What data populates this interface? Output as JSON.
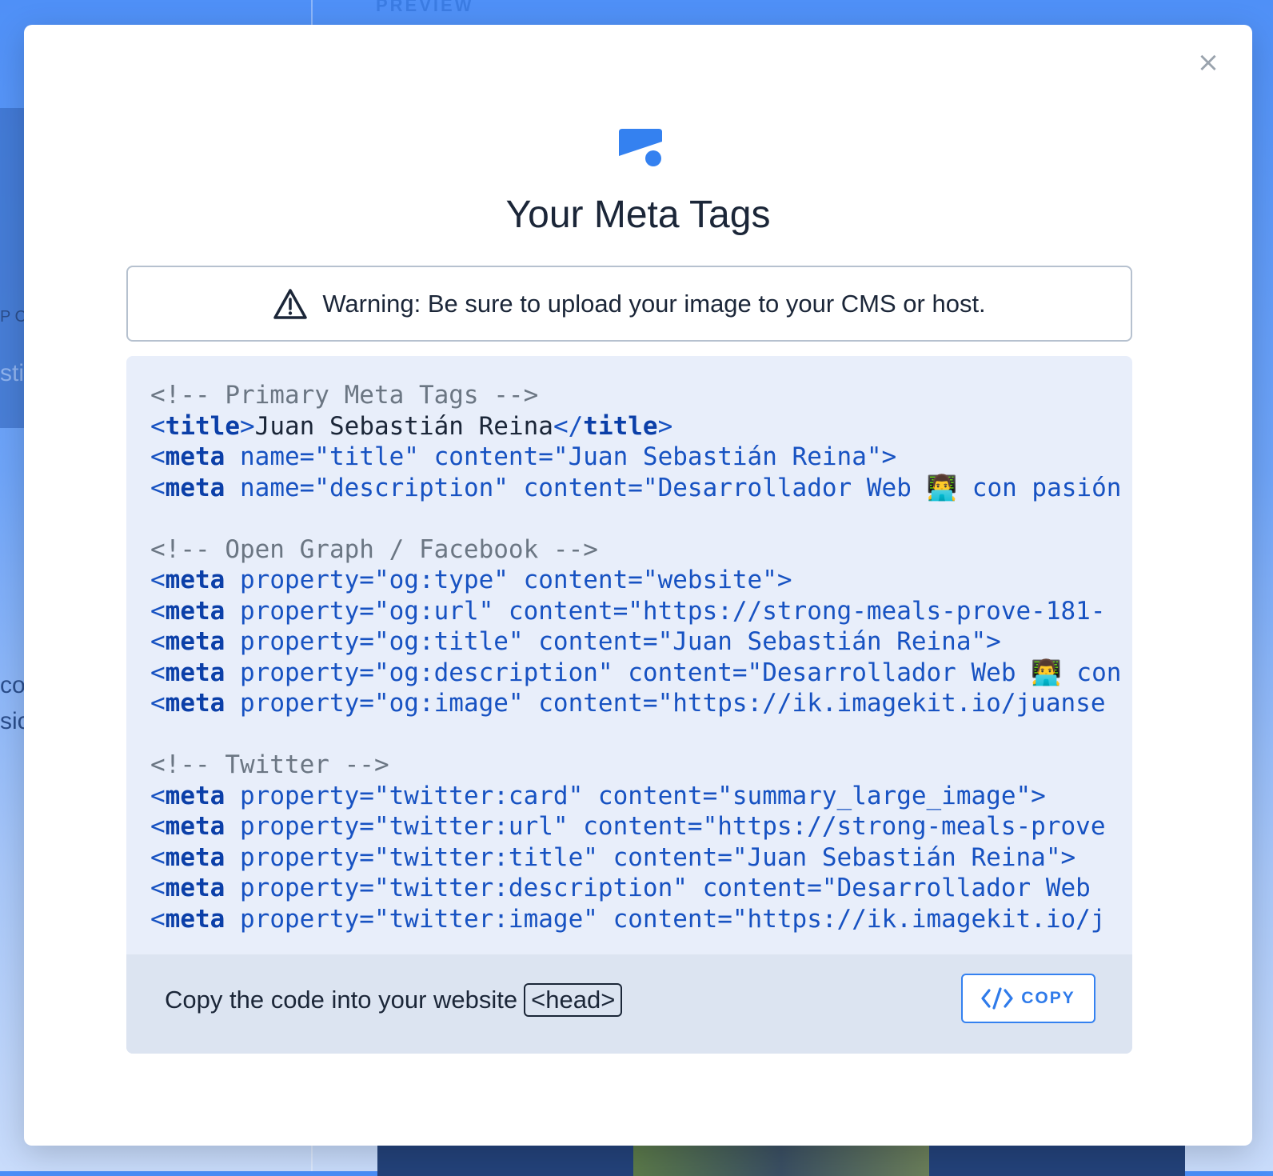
{
  "background": {
    "preview_label": "PREVIEW",
    "left_fragments": [
      "P C",
      "sti",
      "co",
      "sic"
    ]
  },
  "modal": {
    "close_glyph": "×",
    "title": "Your Meta Tags",
    "warning": "Warning: Be sure to upload your image to your CMS or host.",
    "code_lines": [
      {
        "kind": "comment",
        "text": "<!-- Primary Meta Tags -->"
      },
      {
        "kind": "title",
        "open": "<",
        "tag": "title",
        "close": ">",
        "inner": "Juan Sebastián Reina",
        "end_open": "</",
        "end_tag": "title",
        "end_close": ">"
      },
      {
        "kind": "meta",
        "attrs": " name=\"title\" content=\"Juan Sebastián Reina\">"
      },
      {
        "kind": "meta",
        "attrs": " name=\"description\" content=\"Desarrollador Web 👨‍💻 con pasión"
      },
      {
        "kind": "blank"
      },
      {
        "kind": "comment",
        "text": "<!-- Open Graph / Facebook -->"
      },
      {
        "kind": "meta",
        "attrs": " property=\"og:type\" content=\"website\">"
      },
      {
        "kind": "meta",
        "attrs": " property=\"og:url\" content=\"https://strong-meals-prove-181-"
      },
      {
        "kind": "meta",
        "attrs": " property=\"og:title\" content=\"Juan Sebastián Reina\">"
      },
      {
        "kind": "meta",
        "attrs": " property=\"og:description\" content=\"Desarrollador Web 👨‍💻 con"
      },
      {
        "kind": "meta",
        "attrs": " property=\"og:image\" content=\"https://ik.imagekit.io/juanse"
      },
      {
        "kind": "blank"
      },
      {
        "kind": "comment",
        "text": "<!-- Twitter -->"
      },
      {
        "kind": "meta",
        "attrs": " property=\"twitter:card\" content=\"summary_large_image\">"
      },
      {
        "kind": "meta",
        "attrs": " property=\"twitter:url\" content=\"https://strong-meals-prove"
      },
      {
        "kind": "meta",
        "attrs": " property=\"twitter:title\" content=\"Juan Sebastián Reina\">"
      },
      {
        "kind": "meta",
        "attrs": " property=\"twitter:description\" content=\"Desarrollador Web"
      },
      {
        "kind": "meta",
        "attrs": " property=\"twitter:image\" content=\"https://ik.imagekit.io/j"
      }
    ],
    "meta_open": "<",
    "meta_tag": "meta",
    "footer": {
      "instruction": "Copy the code into your website",
      "head_tag": "<head>",
      "copy_label": "COPY"
    }
  },
  "colors": {
    "accent": "#3481f0",
    "code_bg": "#e8eefa",
    "footer_bg": "#dce4f1",
    "tag_color": "#0b3fa8",
    "comment_color": "#6b7683"
  }
}
